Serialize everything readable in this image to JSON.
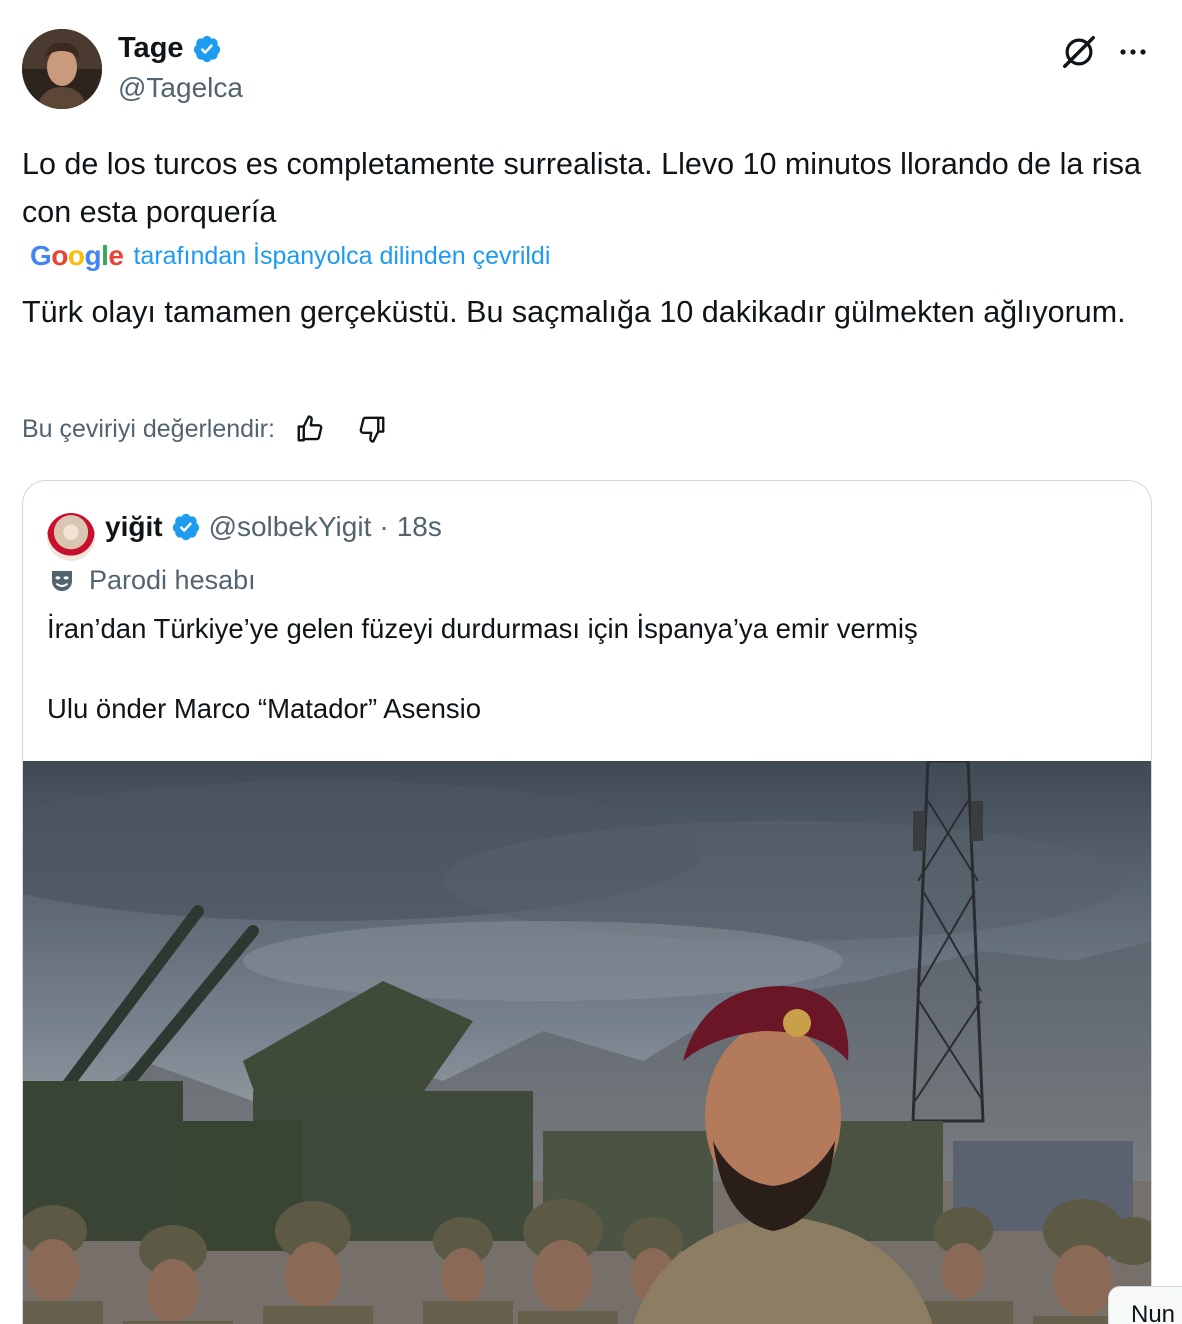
{
  "author": {
    "display_name": "Tage",
    "handle": "@Tagelca",
    "avatar_icon": "user-avatar",
    "verified_icon": "verified-badge-icon",
    "verified_color": "#1d9bf0"
  },
  "header_actions": {
    "grok_icon": "grok-icon",
    "more_icon": "more-options-icon"
  },
  "tweet": {
    "text": "Lo de los turcos es completamente surrealista. Llevo 10 minutos llorando de la risa con esta porquería",
    "translation_provider": "Google",
    "translated_label": "tarafından İspanyolca dilinden çevrildi",
    "translated_text": "Türk olayı tamamen gerçeküstü. Bu saçmalığa 10 dakikadır gülmekten ağlıyorum.",
    "rate_label": "Bu çeviriyi değerlendir:",
    "thumb_up_icon": "thumbs-up-icon",
    "thumb_down_icon": "thumbs-down-icon"
  },
  "quote": {
    "display_name": "yiğit",
    "handle": "@solbekYigit",
    "separator": "·",
    "time": "18s",
    "parody_label": "Parodi hesabı",
    "text_lines": [
      "İran’dan Türkiye’ye gelen füzeyi durdurması için İspanya’ya emir vermiş",
      "",
      "Ulu önder Marco “Matador” Asensio"
    ],
    "media_icon": "photo-soldiers-air-defense"
  },
  "corner_chip": "Nun",
  "colors": {
    "text_primary": "#0f1419",
    "text_secondary": "#536471",
    "link": "#1d9bf0",
    "border": "#cfd9de"
  }
}
